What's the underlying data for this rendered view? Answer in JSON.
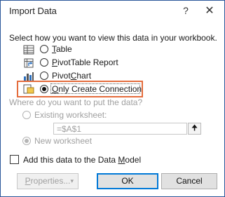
{
  "dialog": {
    "title": "Import Data",
    "help_glyph": "?",
    "close_glyph": "✕"
  },
  "view_section": {
    "prompt": "Select how you want to view this data in your workbook.",
    "options": [
      {
        "underline": "T",
        "rest": "able",
        "selected": false,
        "icon": "table-icon"
      },
      {
        "underline": "P",
        "rest": "ivotTable Report",
        "selected": false,
        "icon": "pivottable-icon"
      },
      {
        "pre": "Pivot",
        "underline": "C",
        "rest": "hart",
        "selected": false,
        "icon": "pivotchart-icon"
      },
      {
        "underline": "O",
        "rest": "nly Create Connection",
        "selected": true,
        "icon": "connection-icon"
      }
    ]
  },
  "location_section": {
    "prompt": "Where do you want to put the data?",
    "existing_label": "Existing worksheet:",
    "existing_value": "=$A$1",
    "collapse_glyph": "🠉",
    "new_label": "New worksheet"
  },
  "data_model": {
    "label_pre": "Add this data to the Data ",
    "label_underline": "M",
    "label_rest": "odel",
    "checked": false
  },
  "buttons": {
    "properties_pre": "P",
    "properties_rest": "roperties...",
    "dropdown_glyph": "▾",
    "ok": "OK",
    "cancel": "Cancel"
  }
}
